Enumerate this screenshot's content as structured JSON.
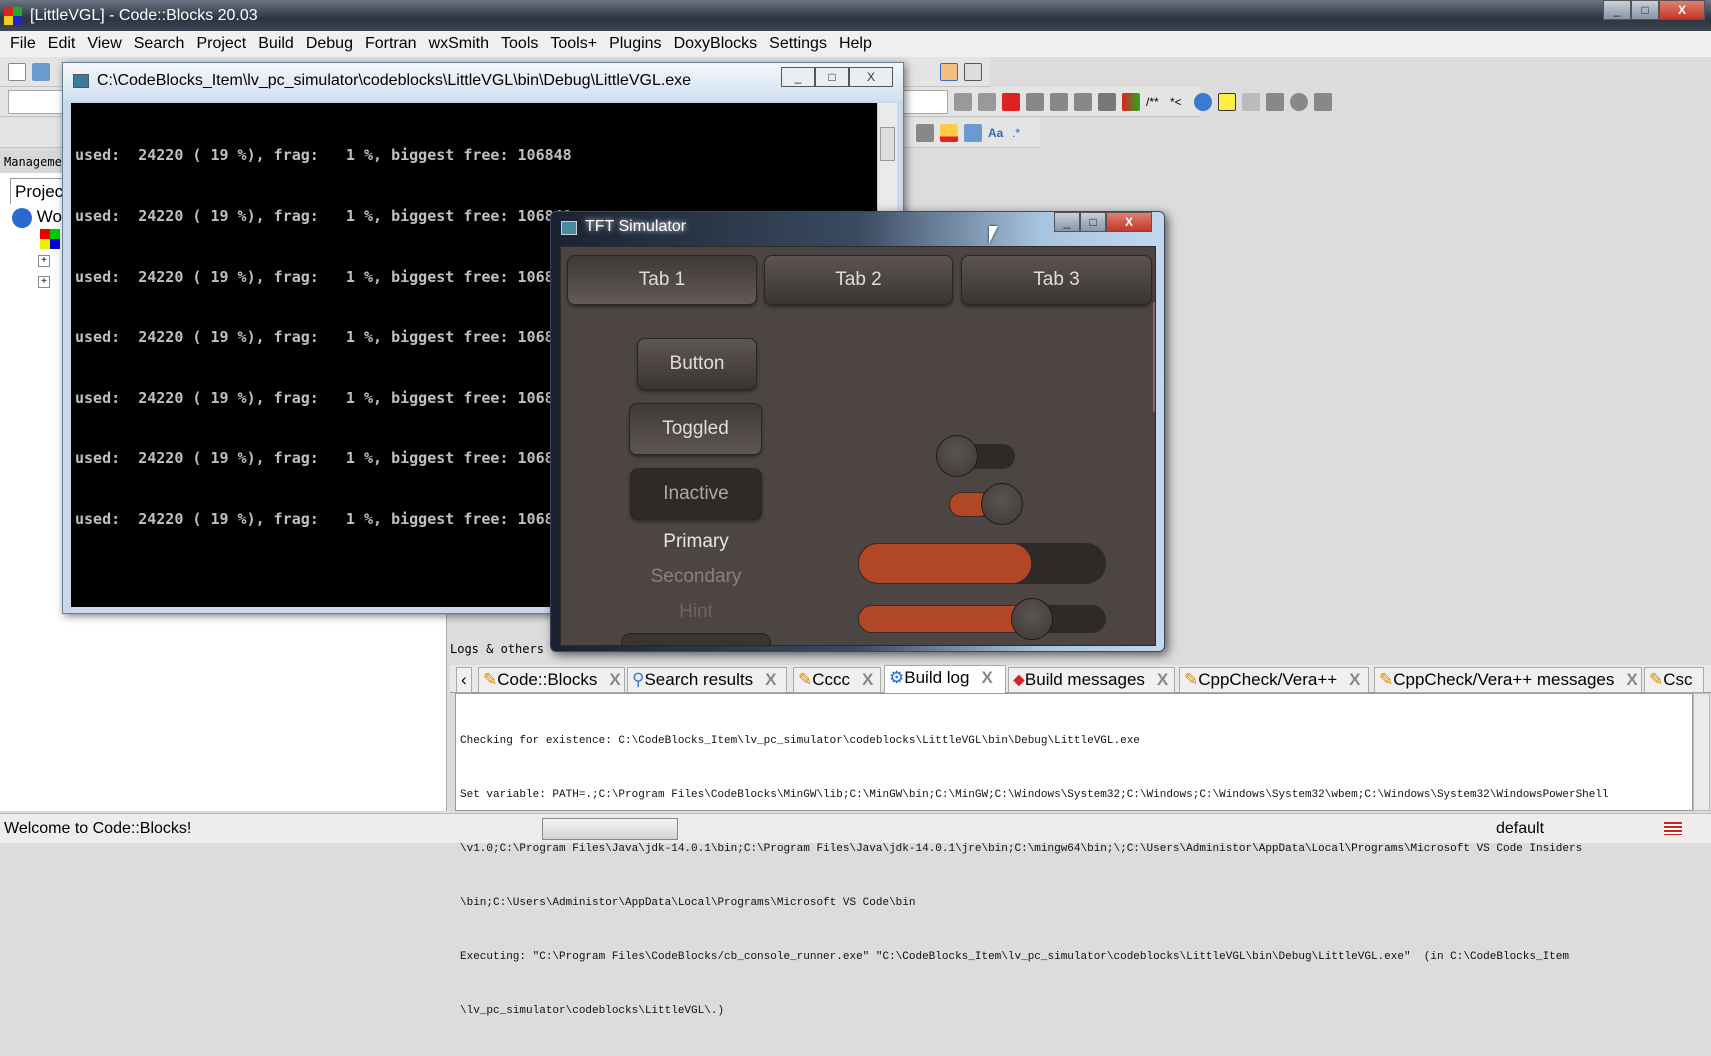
{
  "window": {
    "title": "[LittleVGL] - Code::Blocks 20.03"
  },
  "menu": [
    "File",
    "Edit",
    "View",
    "Search",
    "Project",
    "Build",
    "Debug",
    "Fortran",
    "wxSmith",
    "Tools",
    "Tools+",
    "Plugins",
    "DoxyBlocks",
    "Settings",
    "Help"
  ],
  "left_panel": {
    "header": "Manageme",
    "tab": "Projec",
    "tree": [
      "Wo"
    ]
  },
  "console": {
    "title": "C:\\CodeBlocks_Item\\lv_pc_simulator\\codeblocks\\LittleVGL\\bin\\Debug\\LittleVGL.exe",
    "lines": [
      "used:  24220 ( 19 %), frag:   1 %, biggest free: 106848",
      "used:  24220 ( 19 %), frag:   1 %, biggest free: 106848",
      "used:  24220 ( 19 %), frag:   1 %, biggest free: 106848",
      "used:  24220 ( 19 %), frag:   1 %, biggest free: 106848",
      "used:  24220 ( 19 %), frag:   1 %, biggest free: 106848",
      "used:  24220 ( 19 %), frag:   1 %, biggest free: 106848",
      "used:  24220 ( 19 %), frag:   1 %, biggest free: 106848"
    ]
  },
  "tft": {
    "title": "TFT Simulator",
    "tabs": [
      "Tab 1",
      "Tab 2",
      "Tab 3"
    ],
    "active_tab": 0,
    "buttons": {
      "button": "Button",
      "toggled": "Toggled",
      "inactive": "Inactive"
    },
    "labels": {
      "primary": "Primary",
      "secondary": "Secondary",
      "hint": "Hint"
    },
    "switch1_on": false,
    "switch2_on": true,
    "bar_value_pct": 70,
    "slider_value_pct": 70,
    "accent": "#b24726"
  },
  "logs": {
    "header": "Logs & others",
    "tabs": [
      "Code::Blocks",
      "Search results",
      "Cccc",
      "Build log",
      "Build messages",
      "CppCheck/Vera++",
      "CppCheck/Vera++ messages",
      "Csc"
    ],
    "active_tab": 3,
    "lines": [
      "Checking for existence: C:\\CodeBlocks_Item\\lv_pc_simulator\\codeblocks\\LittleVGL\\bin\\Debug\\LittleVGL.exe",
      "Set variable: PATH=.;C:\\Program Files\\CodeBlocks\\MinGW\\lib;C:\\MinGW\\bin;C:\\MinGW;C:\\Windows\\System32;C:\\Windows;C:\\Windows\\System32\\wbem;C:\\Windows\\System32\\WindowsPowerShell",
      "\\v1.0;C:\\Program Files\\Java\\jdk-14.0.1\\bin;C:\\Program Files\\Java\\jdk-14.0.1\\jre\\bin;C:\\mingw64\\bin;\\;C:\\Users\\Administor\\AppData\\Local\\Programs\\Microsoft VS Code Insiders",
      "\\bin;C:\\Users\\Administor\\AppData\\Local\\Programs\\Microsoft VS Code\\bin",
      "Executing: \"C:\\Program Files\\CodeBlocks/cb_console_runner.exe\" \"C:\\CodeBlocks_Item\\lv_pc_simulator\\codeblocks\\LittleVGL\\bin\\Debug\\LittleVGL.exe\"  (in C:\\CodeBlocks_Item",
      "\\lv_pc_simulator\\codeblocks\\LittleVGL\\.)"
    ]
  },
  "status": {
    "message": "Welcome to Code::Blocks!",
    "profile": "default"
  }
}
